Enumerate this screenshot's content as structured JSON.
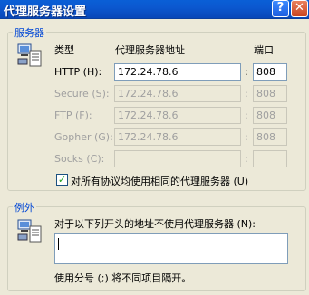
{
  "window": {
    "title": "代理服务器设置",
    "help_glyph": "?",
    "close_glyph": "✕"
  },
  "servers": {
    "legend": "服务器",
    "col_type": "类型",
    "col_address": "代理服务器地址",
    "col_port": "端口",
    "rows": [
      {
        "label": "HTTP (H):",
        "address": "172.24.78.6",
        "port": "808",
        "enabled": true
      },
      {
        "label": "Secure (S):",
        "address": "172.24.78.6",
        "port": "808",
        "enabled": false
      },
      {
        "label": "FTP (F):",
        "address": "172.24.78.6",
        "port": "808",
        "enabled": false
      },
      {
        "label": "Gopher (G):",
        "address": "172.24.78.6",
        "port": "808",
        "enabled": false
      },
      {
        "label": "Socks (C):",
        "address": "",
        "port": "",
        "enabled": false
      }
    ],
    "same_proxy_label": "对所有协议均使用相同的代理服务器 (U)",
    "same_proxy_checked": true,
    "icon": "proxy-servers-icon"
  },
  "exceptions": {
    "legend": "例外",
    "description": "对于以下列开头的地址不使用代理服务器 (N):",
    "value": "",
    "hint": "使用分号 (;) 将不同项目隔开。",
    "icon": "exceptions-icon"
  }
}
